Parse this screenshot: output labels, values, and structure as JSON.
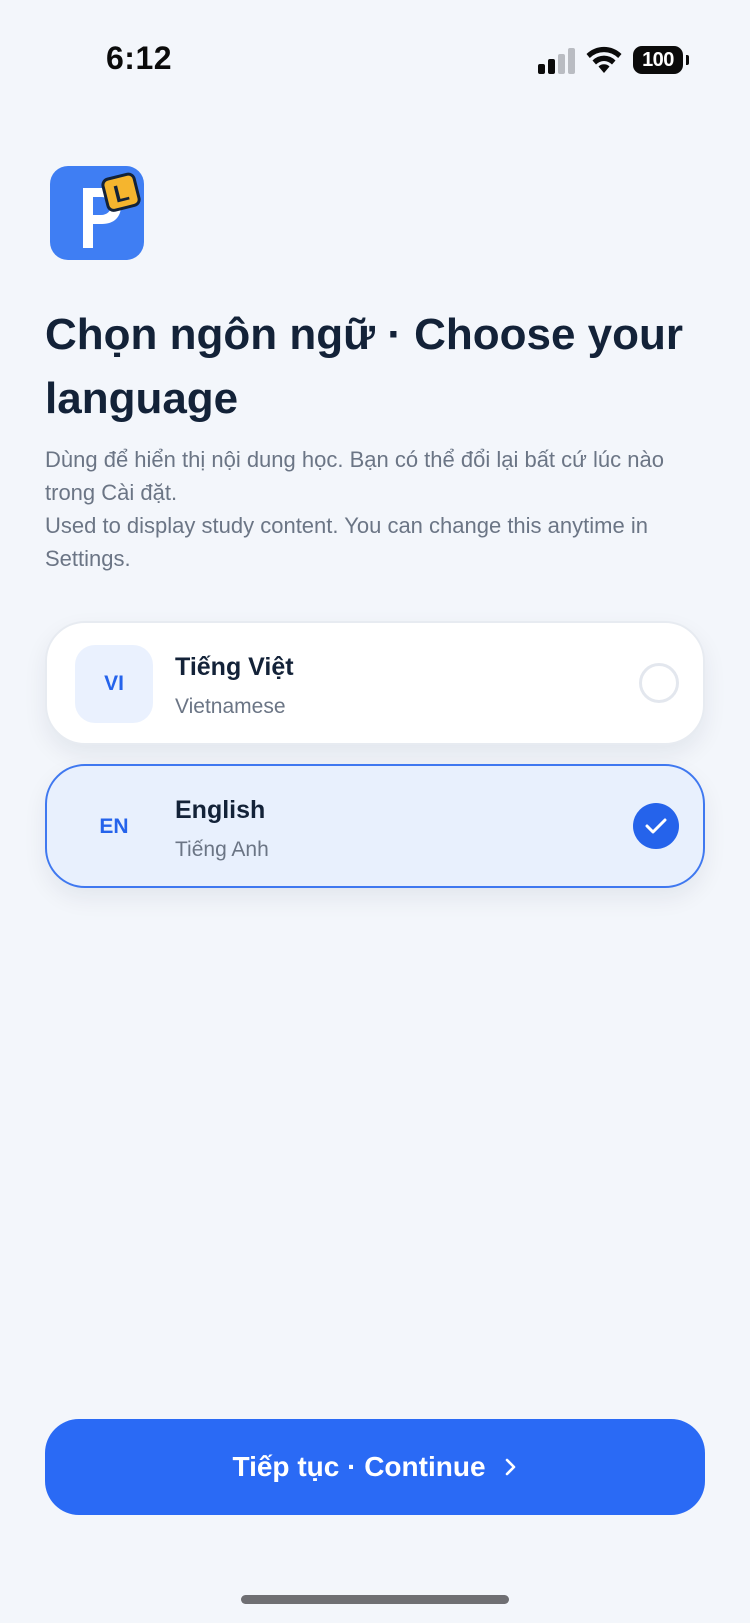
{
  "status_bar": {
    "time": "6:12",
    "battery": "100",
    "icons": [
      "signal-icon",
      "wifi-icon",
      "battery-icon"
    ]
  },
  "logo": {
    "icon": "app-logo-icon",
    "letter": "L",
    "colors": {
      "background": "#3f7ef3",
      "tag": "#f5b52e"
    }
  },
  "header": {
    "title": "Chọn ngôn ngữ · Choose your language",
    "subtitle_vi": "Dùng để hiển thị nội dung học. Bạn có thể đổi lại bất cứ lúc nào trong Cài đặt.",
    "subtitle_en": "Used to display study content. You can change this anytime in Settings."
  },
  "options": [
    {
      "code": "VI",
      "title": "Tiếng Việt",
      "subtitle": "Vietnamese",
      "selected": false
    },
    {
      "code": "EN",
      "title": "English",
      "subtitle": "Tiếng Anh",
      "selected": true
    }
  ],
  "continue_button": {
    "label": "Tiếp tục · Continue",
    "icon": "chevron-right-icon"
  },
  "colors": {
    "accent": "#2a6af5",
    "background": "#f3f6fb",
    "selected_bg": "#e8f0fd",
    "text": "#132238",
    "muted": "#6b7585"
  }
}
